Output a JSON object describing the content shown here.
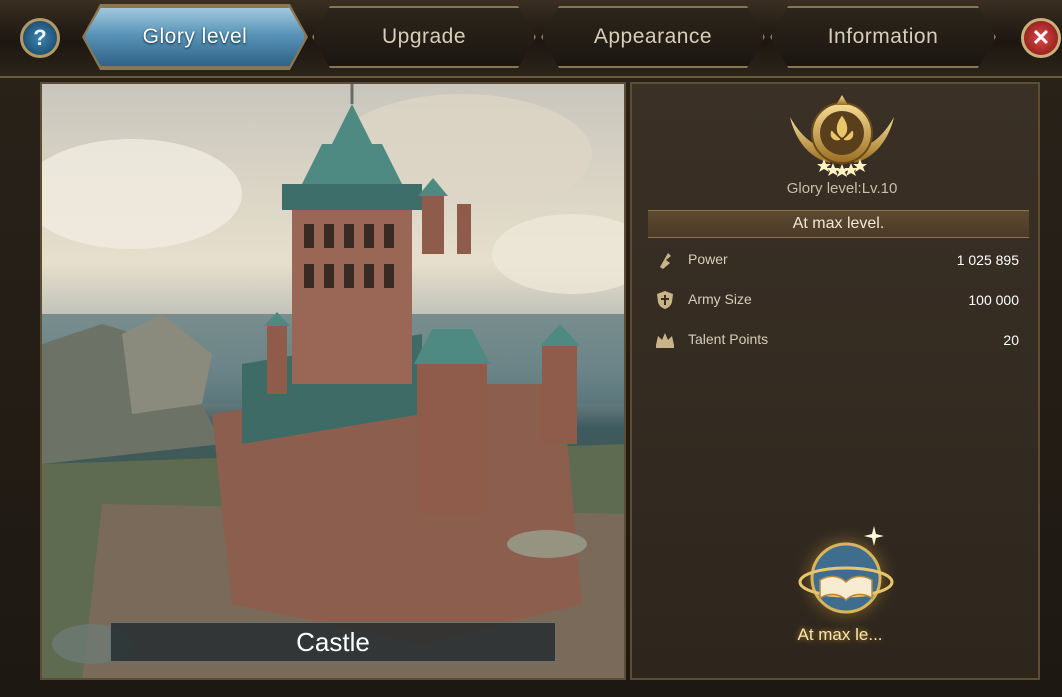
{
  "tabs": [
    {
      "label": "Glory level",
      "active": true
    },
    {
      "label": "Upgrade",
      "active": false
    },
    {
      "label": "Appearance",
      "active": false
    },
    {
      "label": "Information",
      "active": false
    }
  ],
  "help_button": "?",
  "close_button": "✕",
  "building_name": "Castle",
  "glory": {
    "level_text": "Glory level:Lv.10",
    "status_banner": "At max level.",
    "emblem_stars": 5
  },
  "stats": [
    {
      "icon": "power-icon",
      "label": "Power",
      "value": "1 025 895"
    },
    {
      "icon": "army-shield-icon",
      "label": "Army Size",
      "value": "100 000"
    },
    {
      "icon": "crown-icon",
      "label": "Talent Points",
      "value": "20"
    }
  ],
  "book_button": {
    "icon": "glowing-book-icon",
    "label": "At max le..."
  },
  "colors": {
    "active_tab": "#5a95b9",
    "frame_gold": "#8c7650",
    "panel_bg": "#33291f",
    "close_red": "#c02a26"
  }
}
